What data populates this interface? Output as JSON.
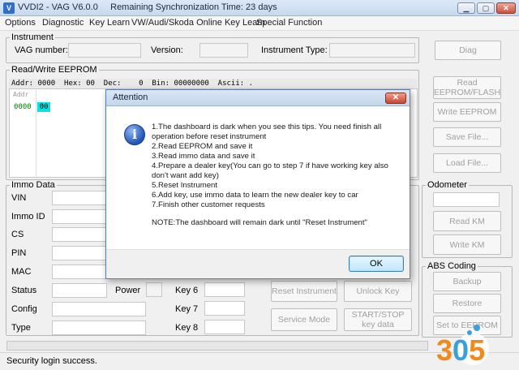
{
  "window": {
    "title": "VVDI2 - VAG V6.0.0",
    "sync_text": "Remaining Synchronization Time: 23 days"
  },
  "menu": [
    "Options",
    "Diagnostic",
    "Key Learn",
    "VW/Audi/Skoda Online Key Learn",
    "Special Function"
  ],
  "instrument": {
    "legend": "Instrument",
    "vag_number_label": "VAG number:",
    "version_label": "Version:",
    "type_label": "Instrument Type:",
    "diag_button": "Diag"
  },
  "eeprom": {
    "legend": "Read/Write EEPROM",
    "addr_bar": "Addr: 0000  Hex: 00  Dec:    0  Bin: 00000000  Ascii: .",
    "grid_header": "Addr",
    "first_addr": "0000",
    "first_cell": "00",
    "buttons": [
      "Read EEPROM/FLASH",
      "Write EEPROM",
      "Save File...",
      "Load File..."
    ]
  },
  "immo": {
    "legend": "Immo Data",
    "labels": [
      "VIN",
      "Immo ID",
      "CS",
      "PIN",
      "MAC",
      "Status",
      "Config",
      "Type"
    ],
    "power_label": "Power",
    "keys": [
      "Key 6",
      "Key 7",
      "Key 8"
    ],
    "buttons": [
      "Reset Instrument",
      "Unlock Key",
      "Service Mode",
      "START/STOP key data"
    ]
  },
  "odometer": {
    "legend": "Odometer",
    "buttons": [
      "Read KM",
      "Write KM"
    ]
  },
  "abs": {
    "legend": "ABS Coding",
    "buttons": [
      "Backup",
      "Restore",
      "Set to EEPROM"
    ]
  },
  "status_bar": "Security login success.",
  "dialog": {
    "title": "Attention",
    "lines": [
      "1.The dashboard is dark when you see this tips. You need finish all",
      "operation before reset instrument",
      "2.Read EEPROM and save it",
      "3.Read immo data and save it",
      "4.Prepare a dealer key(You can go to step 7 if have working key also",
      "don't want add key)",
      "5.Reset Instrument",
      "6.Add key, use immo data to learn the new dealer key to car",
      "7.Finish other customer requests"
    ],
    "note": "NOTE:The dashboard will remain dark until \"Reset Instrument\"",
    "ok_label": "OK"
  },
  "watermark": {
    "text": "305"
  },
  "colors": {
    "accent": "#1f55b8",
    "cell_highlight": "#00e5e5",
    "addr_text": "#008000",
    "watermark_orange": "#f08a1c"
  }
}
